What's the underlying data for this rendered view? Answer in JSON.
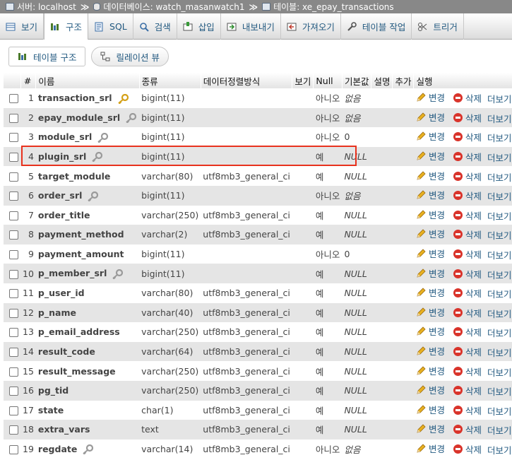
{
  "breadcrumb": {
    "server_label": "서버: localhost",
    "database_label": "데이터베이스: watch_masanwatch1",
    "table_label": "테이블: xe_epay_transactions",
    "separator": "≫"
  },
  "tabs": [
    {
      "label": "보기",
      "icon": "browse-icon"
    },
    {
      "label": "구조",
      "icon": "structure-icon",
      "active": true
    },
    {
      "label": "SQL",
      "icon": "sql-icon"
    },
    {
      "label": "검색",
      "icon": "search-icon"
    },
    {
      "label": "삽입",
      "icon": "insert-icon"
    },
    {
      "label": "내보내기",
      "icon": "export-icon"
    },
    {
      "label": "가져오기",
      "icon": "import-icon"
    },
    {
      "label": "테이블 작업",
      "icon": "wrench-icon"
    },
    {
      "label": "트리거",
      "icon": "trigger-icon"
    }
  ],
  "subnav": {
    "table_structure_label": "테이블 구조",
    "relation_view_label": "릴레이션 뷰"
  },
  "columns": {
    "num": "#",
    "name": "이름",
    "type": "종류",
    "collation": "데이터정렬방식",
    "attributes": "보기",
    "null": "Null",
    "default": "기본값",
    "comment": "설명",
    "extra": "추가",
    "action": "실행"
  },
  "actions": {
    "change": "변경",
    "drop": "삭제",
    "more": "더보기"
  },
  "rows": [
    {
      "num": "1",
      "name": "transaction_srl",
      "key": "primary",
      "type": "bigint(11)",
      "collation": "",
      "null": "아니오",
      "default": "없음",
      "default_italic": true
    },
    {
      "num": "2",
      "name": "epay_module_srl",
      "key": "index",
      "type": "bigint(11)",
      "collation": "",
      "null": "아니오",
      "default": "없음",
      "default_italic": true
    },
    {
      "num": "3",
      "name": "module_srl",
      "key": "index",
      "type": "bigint(11)",
      "collation": "",
      "null": "아니오",
      "default": "0",
      "default_italic": false
    },
    {
      "num": "4",
      "name": "plugin_srl",
      "key": "index",
      "type": "bigint(11)",
      "collation": "",
      "null": "예",
      "default": "NULL",
      "default_italic": true
    },
    {
      "num": "5",
      "name": "target_module",
      "key": "",
      "type": "varchar(80)",
      "collation": "utf8mb3_general_ci",
      "null": "예",
      "default": "NULL",
      "default_italic": true
    },
    {
      "num": "6",
      "name": "order_srl",
      "key": "index",
      "type": "bigint(11)",
      "collation": "",
      "null": "아니오",
      "default": "없음",
      "default_italic": true
    },
    {
      "num": "7",
      "name": "order_title",
      "key": "",
      "type": "varchar(250)",
      "collation": "utf8mb3_general_ci",
      "null": "예",
      "default": "NULL",
      "default_italic": true
    },
    {
      "num": "8",
      "name": "payment_method",
      "key": "",
      "type": "varchar(2)",
      "collation": "utf8mb3_general_ci",
      "null": "예",
      "default": "NULL",
      "default_italic": true
    },
    {
      "num": "9",
      "name": "payment_amount",
      "key": "",
      "type": "bigint(11)",
      "collation": "",
      "null": "아니오",
      "default": "0",
      "default_italic": false
    },
    {
      "num": "10",
      "name": "p_member_srl",
      "key": "index",
      "type": "bigint(11)",
      "collation": "",
      "null": "예",
      "default": "NULL",
      "default_italic": true
    },
    {
      "num": "11",
      "name": "p_user_id",
      "key": "",
      "type": "varchar(80)",
      "collation": "utf8mb3_general_ci",
      "null": "예",
      "default": "NULL",
      "default_italic": true
    },
    {
      "num": "12",
      "name": "p_name",
      "key": "",
      "type": "varchar(40)",
      "collation": "utf8mb3_general_ci",
      "null": "예",
      "default": "NULL",
      "default_italic": true
    },
    {
      "num": "13",
      "name": "p_email_address",
      "key": "",
      "type": "varchar(250)",
      "collation": "utf8mb3_general_ci",
      "null": "예",
      "default": "NULL",
      "default_italic": true
    },
    {
      "num": "14",
      "name": "result_code",
      "key": "",
      "type": "varchar(64)",
      "collation": "utf8mb3_general_ci",
      "null": "예",
      "default": "NULL",
      "default_italic": true
    },
    {
      "num": "15",
      "name": "result_message",
      "key": "",
      "type": "varchar(250)",
      "collation": "utf8mb3_general_ci",
      "null": "예",
      "default": "NULL",
      "default_italic": true
    },
    {
      "num": "16",
      "name": "pg_tid",
      "key": "",
      "type": "varchar(250)",
      "collation": "utf8mb3_general_ci",
      "null": "예",
      "default": "NULL",
      "default_italic": true
    },
    {
      "num": "17",
      "name": "state",
      "key": "",
      "type": "char(1)",
      "collation": "utf8mb3_general_ci",
      "null": "예",
      "default": "NULL",
      "default_italic": true
    },
    {
      "num": "18",
      "name": "extra_vars",
      "key": "",
      "type": "text",
      "collation": "utf8mb3_general_ci",
      "null": "예",
      "default": "NULL",
      "default_italic": true
    },
    {
      "num": "19",
      "name": "regdate",
      "key": "index",
      "type": "varchar(14)",
      "collation": "utf8mb3_general_ci",
      "null": "아니오",
      "default": "없음",
      "default_italic": true
    }
  ],
  "highlighted_row": "4",
  "colors": {
    "breadcrumb_bg": "#888888",
    "link": "#235a81",
    "highlight_border": "#e8321e",
    "primary_key": "#d4a017",
    "index_key": "#9a9a9a",
    "drop": "#d9342b",
    "change_pencil": "#e8b020"
  }
}
